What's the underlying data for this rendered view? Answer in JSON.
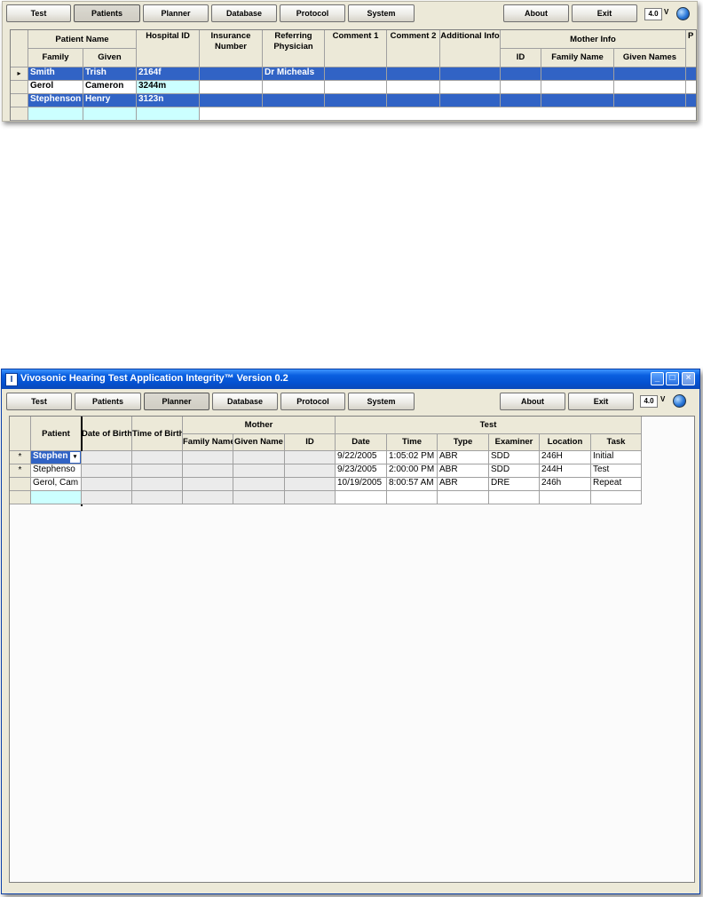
{
  "top_window": {
    "nav_buttons": [
      "Test",
      "Patients",
      "Planner",
      "Database",
      "Protocol",
      "System"
    ],
    "right_buttons": [
      "About",
      "Exit"
    ],
    "version": "4.0",
    "version_suffix": "V",
    "table": {
      "group_patient_name": "Patient Name",
      "col_family": "Family",
      "col_given": "Given",
      "col_hospital_id": "Hospital ID",
      "col_insurance": "Insurance Number",
      "col_referring": "Referring Physician",
      "col_comment1": "Comment 1",
      "col_comment2": "Comment 2",
      "col_additional": "Additional Info",
      "group_mother": "Mother Info",
      "col_mother_id": "ID",
      "col_mother_family": "Family Name",
      "col_mother_given": "Given Names",
      "col_partial": "P",
      "row_indicator": "▸",
      "rows": [
        {
          "family": "Smith",
          "given": "Trish",
          "hospital_id": "2164f",
          "referring": "Dr Micheals"
        },
        {
          "family": "Gerol",
          "given": "Cameron",
          "hospital_id": "3244m",
          "referring": ""
        },
        {
          "family": "Stephenson",
          "given": "Henry",
          "hospital_id": "3123n",
          "referring": ""
        }
      ]
    }
  },
  "main_window": {
    "title": "Vivosonic Hearing Test Application Integrity™ Version 0.2",
    "app_icon": "I",
    "controls": {
      "minimize": "_",
      "maximize": "□",
      "close": "×"
    },
    "nav_buttons": [
      "Test",
      "Patients",
      "Planner",
      "Database",
      "Protocol",
      "System"
    ],
    "right_buttons": [
      "About",
      "Exit"
    ],
    "version": "4.0",
    "version_suffix": "V",
    "table": {
      "col_patient": "Patient",
      "col_dob": "Date of Birth",
      "col_tob": "Time of Birth",
      "group_mother": "Mother",
      "col_mother_family": "Family Name",
      "col_mother_given": "Given Name",
      "col_mother_id": "ID",
      "group_test": "Test",
      "col_date": "Date",
      "col_time": "Time",
      "col_type": "Type",
      "col_examiner": "Examiner",
      "col_location": "Location",
      "col_task": "Task",
      "rows": [
        {
          "marker": "*",
          "patient": "Stephen",
          "date": "9/22/2005",
          "time": "1:05:02 PM",
          "type": "ABR",
          "examiner": "SDD",
          "location": "246H",
          "task": "Initial"
        },
        {
          "marker": "*",
          "patient": "Stephenso",
          "date": "9/23/2005",
          "time": "2:00:00 PM",
          "type": "ABR",
          "examiner": "SDD",
          "location": "244H",
          "task": "Test"
        },
        {
          "marker": "",
          "patient": "Gerol, Cam",
          "date": "10/19/2005",
          "time": "8:00:57 AM",
          "type": "ABR",
          "examiner": "DRE",
          "location": "246h",
          "task": "Repeat"
        }
      ]
    }
  }
}
